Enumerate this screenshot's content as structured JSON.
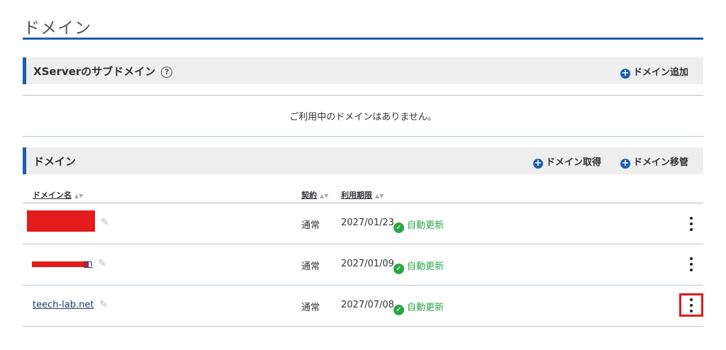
{
  "page": {
    "title": "ドメイン"
  },
  "subdomain_section": {
    "title": "XServerのサブドメイン",
    "help_icon": "question-circle-icon",
    "add_label": "ドメイン追加",
    "empty_message": "ご利用中のドメインはありません。"
  },
  "domain_section": {
    "title": "ドメイン",
    "acquire_label": "ドメイン取得",
    "transfer_label": "ドメイン移管",
    "columns": {
      "domain": "ドメイン名",
      "contract": "契約",
      "expiry": "利用期限"
    },
    "rows": [
      {
        "domain": "",
        "contract": "通常",
        "expiry": "2027/01/23",
        "renewal": "自動更新"
      },
      {
        "domain": "m",
        "contract": "通常",
        "expiry": "2027/01/09",
        "renewal": "自動更新"
      },
      {
        "domain": "teech-lab.net",
        "contract": "通常",
        "expiry": "2027/07/08",
        "renewal": "自動更新"
      }
    ]
  },
  "colors": {
    "accent": "#1d5ea8",
    "success": "#2aa54a",
    "highlight": "#e31b1b"
  }
}
